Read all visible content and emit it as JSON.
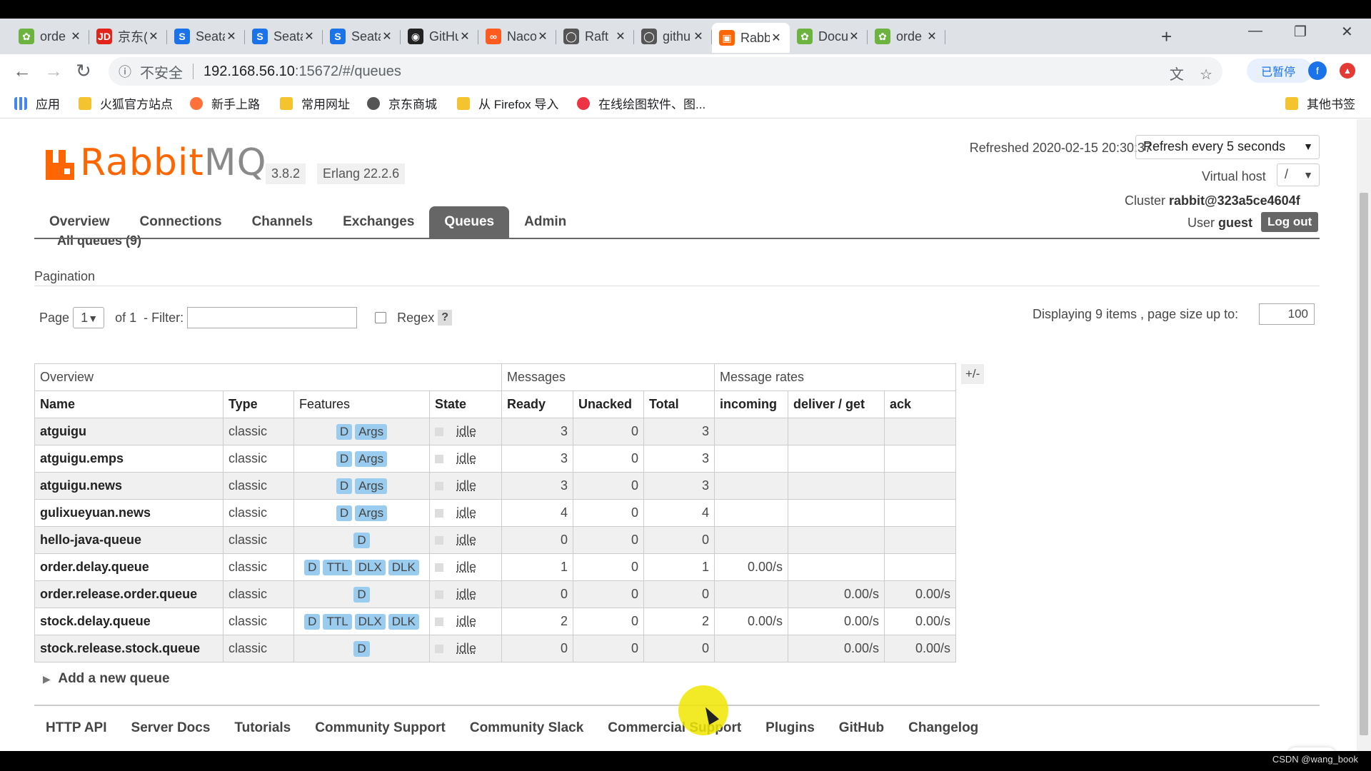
{
  "browser": {
    "tabs": [
      {
        "title": "orde",
        "icon": "leaf-icon",
        "color": "#6db33f"
      },
      {
        "title": "京东(",
        "icon": "jd-icon",
        "color": "#e1251b"
      },
      {
        "title": "Seata",
        "icon": "s-icon",
        "color": "#1a73e8"
      },
      {
        "title": "Seata",
        "icon": "s-icon",
        "color": "#1a73e8"
      },
      {
        "title": "Seata",
        "icon": "s-icon",
        "color": "#1a73e8"
      },
      {
        "title": "GitHu",
        "icon": "github-icon",
        "color": "#222222"
      },
      {
        "title": "Naco",
        "icon": "nacos-icon",
        "color": "#ff5a1f"
      },
      {
        "title": "Raft",
        "icon": "globe-icon",
        "color": "#555555"
      },
      {
        "title": "githu",
        "icon": "globe-icon",
        "color": "#555555"
      },
      {
        "title": "Rabb",
        "icon": "rabbitmq-icon",
        "color": "#ff6600",
        "active": true
      },
      {
        "title": "Docu",
        "icon": "leaf-icon",
        "color": "#6db33f"
      },
      {
        "title": "orde",
        "icon": "leaf-icon",
        "color": "#6db33f"
      }
    ],
    "insecure_label": "不安全",
    "url_host": "192.168.56.10",
    "url_path": ":15672/#/queues",
    "paused_label": "已暂停",
    "avatar_letter": "f",
    "bookmarks": [
      "应用",
      "火狐官方站点",
      "新手上路",
      "常用网址",
      "京东商城",
      "从 Firefox 导入",
      "在线绘图软件、图...",
      "其他书签"
    ]
  },
  "header": {
    "logo_rabbit": "Rabbit",
    "logo_mq": "MQ",
    "version": "3.8.2",
    "erlang": "Erlang 22.2.6",
    "refreshed": "Refreshed 2020-02-15 20:30:37",
    "refresh_option": "Refresh every 5 seconds",
    "vhost_label": "Virtual host",
    "vhost_value": "/",
    "cluster_label": "Cluster",
    "cluster_value": "rabbit@323a5ce4604f",
    "user_label": "User",
    "user_value": "guest",
    "logout": "Log out"
  },
  "nav": [
    "Overview",
    "Connections",
    "Channels",
    "Exchanges",
    "Queues",
    "Admin"
  ],
  "all_queues": "All queues (9)",
  "pagination": {
    "title": "Pagination",
    "page_label": "Page",
    "page_value": "1",
    "of_label": "of 1",
    "filter_label": "- Filter:",
    "regex_label": "Regex",
    "help": "?",
    "displaying": "Displaying 9 items , page size up to:",
    "page_size": "100"
  },
  "table": {
    "group_headers": [
      "Overview",
      "Messages",
      "Message rates"
    ],
    "columns": [
      "Name",
      "Type",
      "Features",
      "State",
      "Ready",
      "Unacked",
      "Total",
      "incoming",
      "deliver / get",
      "ack"
    ],
    "toggle": "+/-",
    "rows": [
      {
        "name": "atguigu",
        "type": "classic",
        "features": [
          "D",
          "Args"
        ],
        "state": "idle",
        "ready": "3",
        "unacked": "0",
        "total": "3",
        "incoming": "",
        "deliver": "",
        "ack": ""
      },
      {
        "name": "atguigu.emps",
        "type": "classic",
        "features": [
          "D",
          "Args"
        ],
        "state": "idle",
        "ready": "3",
        "unacked": "0",
        "total": "3",
        "incoming": "",
        "deliver": "",
        "ack": ""
      },
      {
        "name": "atguigu.news",
        "type": "classic",
        "features": [
          "D",
          "Args"
        ],
        "state": "idle",
        "ready": "3",
        "unacked": "0",
        "total": "3",
        "incoming": "",
        "deliver": "",
        "ack": ""
      },
      {
        "name": "gulixueyuan.news",
        "type": "classic",
        "features": [
          "D",
          "Args"
        ],
        "state": "idle",
        "ready": "4",
        "unacked": "0",
        "total": "4",
        "incoming": "",
        "deliver": "",
        "ack": ""
      },
      {
        "name": "hello-java-queue",
        "type": "classic",
        "features": [
          "D"
        ],
        "state": "idle",
        "ready": "0",
        "unacked": "0",
        "total": "0",
        "incoming": "",
        "deliver": "",
        "ack": ""
      },
      {
        "name": "order.delay.queue",
        "type": "classic",
        "features": [
          "D",
          "TTL",
          "DLX",
          "DLK"
        ],
        "state": "idle",
        "ready": "1",
        "unacked": "0",
        "total": "1",
        "incoming": "0.00/s",
        "deliver": "",
        "ack": ""
      },
      {
        "name": "order.release.order.queue",
        "type": "classic",
        "features": [
          "D"
        ],
        "state": "idle",
        "ready": "0",
        "unacked": "0",
        "total": "0",
        "incoming": "",
        "deliver": "0.00/s",
        "ack": "0.00/s"
      },
      {
        "name": "stock.delay.queue",
        "type": "classic",
        "features": [
          "D",
          "TTL",
          "DLX",
          "DLK"
        ],
        "state": "idle",
        "ready": "2",
        "unacked": "0",
        "total": "2",
        "incoming": "0.00/s",
        "deliver": "0.00/s",
        "ack": "0.00/s"
      },
      {
        "name": "stock.release.stock.queue",
        "type": "classic",
        "features": [
          "D"
        ],
        "state": "idle",
        "ready": "0",
        "unacked": "0",
        "total": "0",
        "incoming": "",
        "deliver": "0.00/s",
        "ack": "0.00/s"
      }
    ]
  },
  "add_queue": "Add a new queue",
  "footer": [
    "HTTP API",
    "Server Docs",
    "Tutorials",
    "Community Support",
    "Community Slack",
    "Commercial Support",
    "Plugins",
    "GitHub",
    "Changelog"
  ],
  "watermark": "CSDN @wang_book"
}
